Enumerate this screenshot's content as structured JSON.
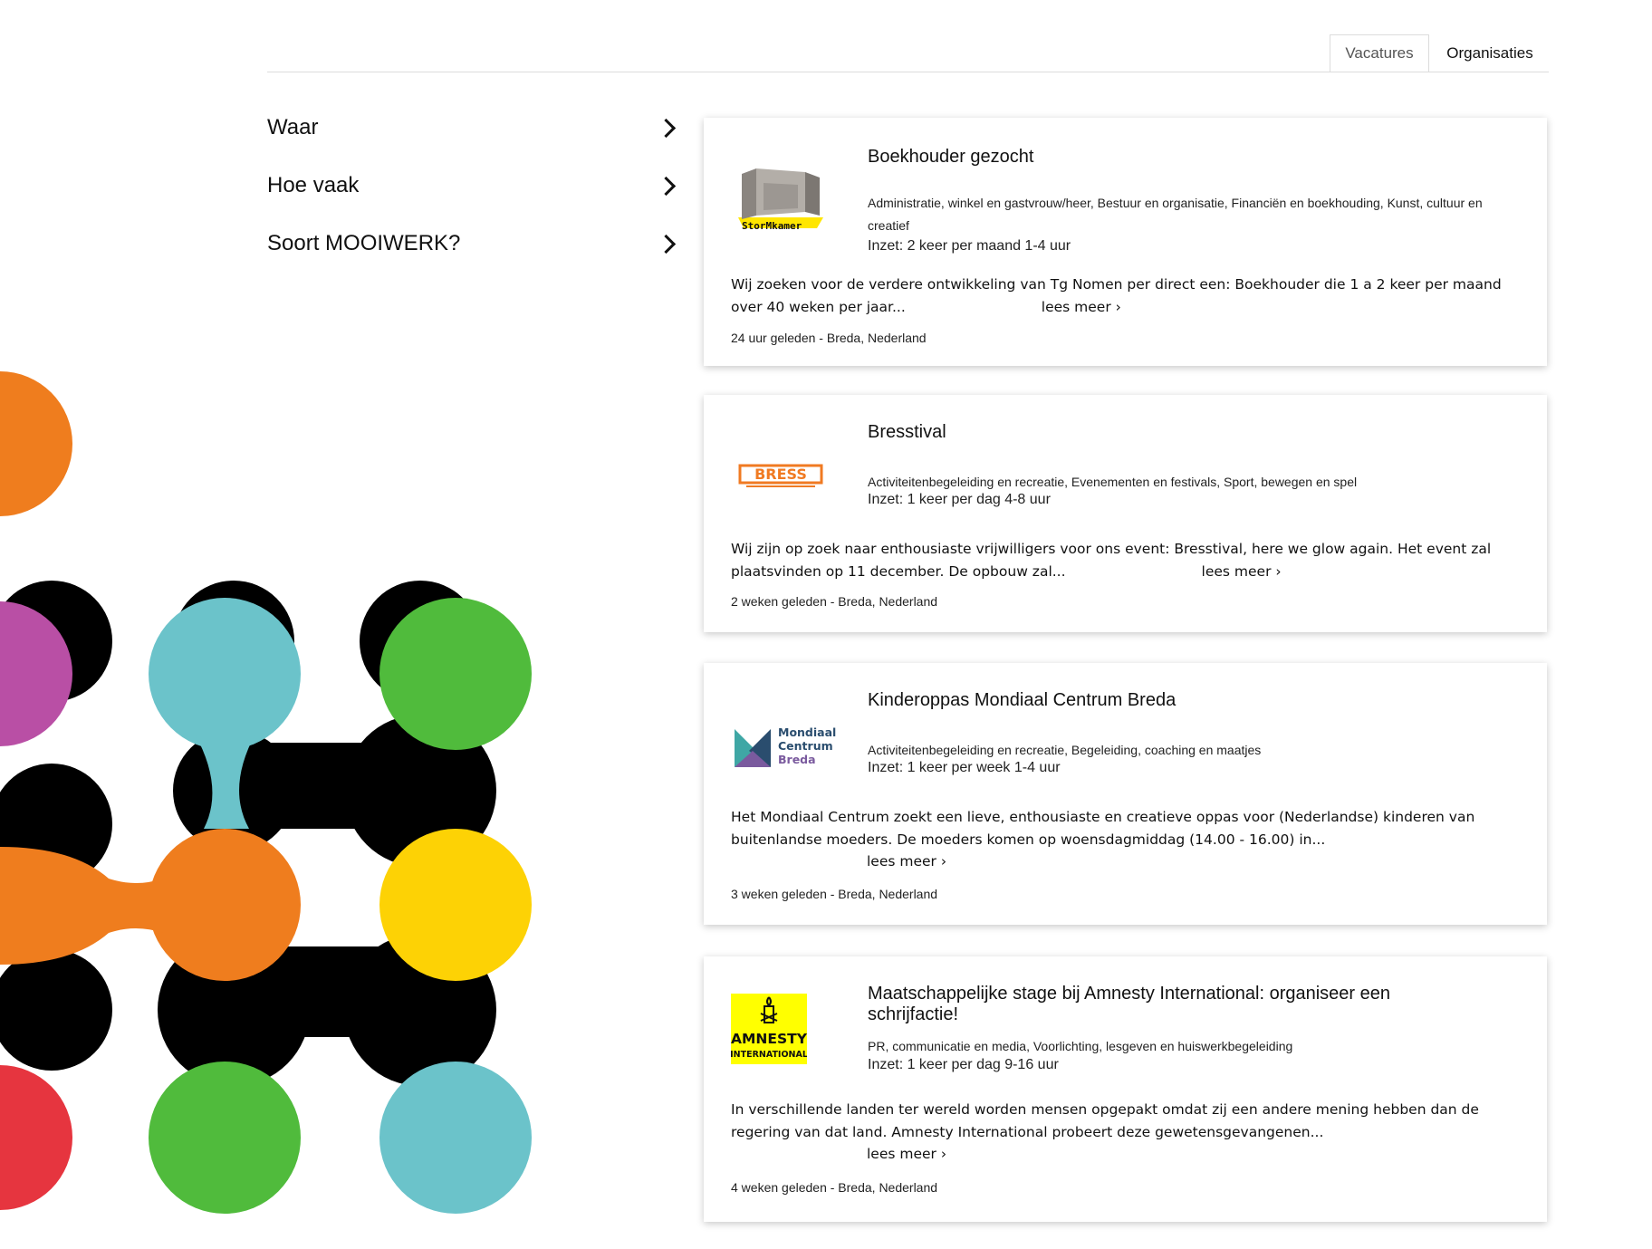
{
  "tabs": {
    "vacatures": "Vacatures",
    "organisaties": "Organisaties"
  },
  "filters": {
    "waar": "Waar",
    "hoe_vaak": "Hoe vaak",
    "soort": "Soort MOOIWERK?"
  },
  "cards": [
    {
      "title": "Boekhouder gezocht",
      "categories": "Administratie, winkel en gastvrouw/heer, Bestuur en organisatie, Financiën en boekhouding, Kunst, cultuur en creatief",
      "inzet": "Inzet: 2 keer per maand 1-4 uur",
      "description": "Wij zoeken voor de verdere ontwikkeling van Tg Nomen per direct een: Boekhouder die  1 a 2 keer per maand over 40 weken per jaar...",
      "read_more": "lees meer ›",
      "meta": "24 uur geleden - Breda, Nederland",
      "logo_text": "StorMkamer"
    },
    {
      "title": "Bresstival",
      "categories": "Activiteitenbegeleiding en recreatie, Evenementen en festivals, Sport, bewegen en spel",
      "inzet": "Inzet: 1 keer per dag 4-8 uur",
      "description": "Wij zijn op zoek naar enthousiaste vrijwilligers voor ons event: Bresstival, here we glow again. Het event zal plaatsvinden op 11 december. De opbouw zal...",
      "read_more": "lees meer ›",
      "meta": "2 weken geleden - Breda, Nederland",
      "logo_text": "BRESS"
    },
    {
      "title": "Kinderoppas Mondiaal Centrum Breda",
      "categories": "Activiteitenbegeleiding en recreatie, Begeleiding, coaching en maatjes",
      "inzet": "Inzet: 1 keer per week 1-4 uur",
      "description": "Het Mondiaal Centrum zoekt een lieve, enthousiaste en creatieve oppas voor (Nederlandse) kinderen van buitenlandse moeders. De moeders komen op woensdagmiddag (14.00 - 16.00) in...",
      "read_more": "lees meer ›",
      "meta": "3 weken geleden - Breda, Nederland",
      "logo_lines": [
        "Mondiaal",
        "Centrum",
        "Breda"
      ]
    },
    {
      "title": "Maatschappelijke stage bij Amnesty International: organiseer een schrijfactie!",
      "categories": "PR, communicatie en media, Voorlichting, lesgeven en huiswerkbegeleiding",
      "inzet": "Inzet: 1 keer per dag 9-16 uur",
      "description": "In verschillende landen ter wereld worden mensen opgepakt omdat zij een andere mening hebben dan de regering van dat land. Amnesty International probeert deze gewetensgevangenen...",
      "read_more": "lees meer ›",
      "meta": "4 weken geleden - Breda, Nederland",
      "logo_lines": [
        "AMNESTY",
        "INTERNATIONAL"
      ]
    }
  ],
  "colors": {
    "orange": "#EF7D1E",
    "black": "#000000",
    "magenta": "#B94FA5",
    "teal": "#6BC3CA",
    "green": "#50BB3C",
    "yellow": "#FDD205",
    "red": "#E6353F",
    "amnesty_yellow": "#FFFF00",
    "bress_orange": "#F07A22",
    "mondiaal_teal": "#3FA7A5",
    "mondiaal_purple": "#7A5A9E"
  }
}
